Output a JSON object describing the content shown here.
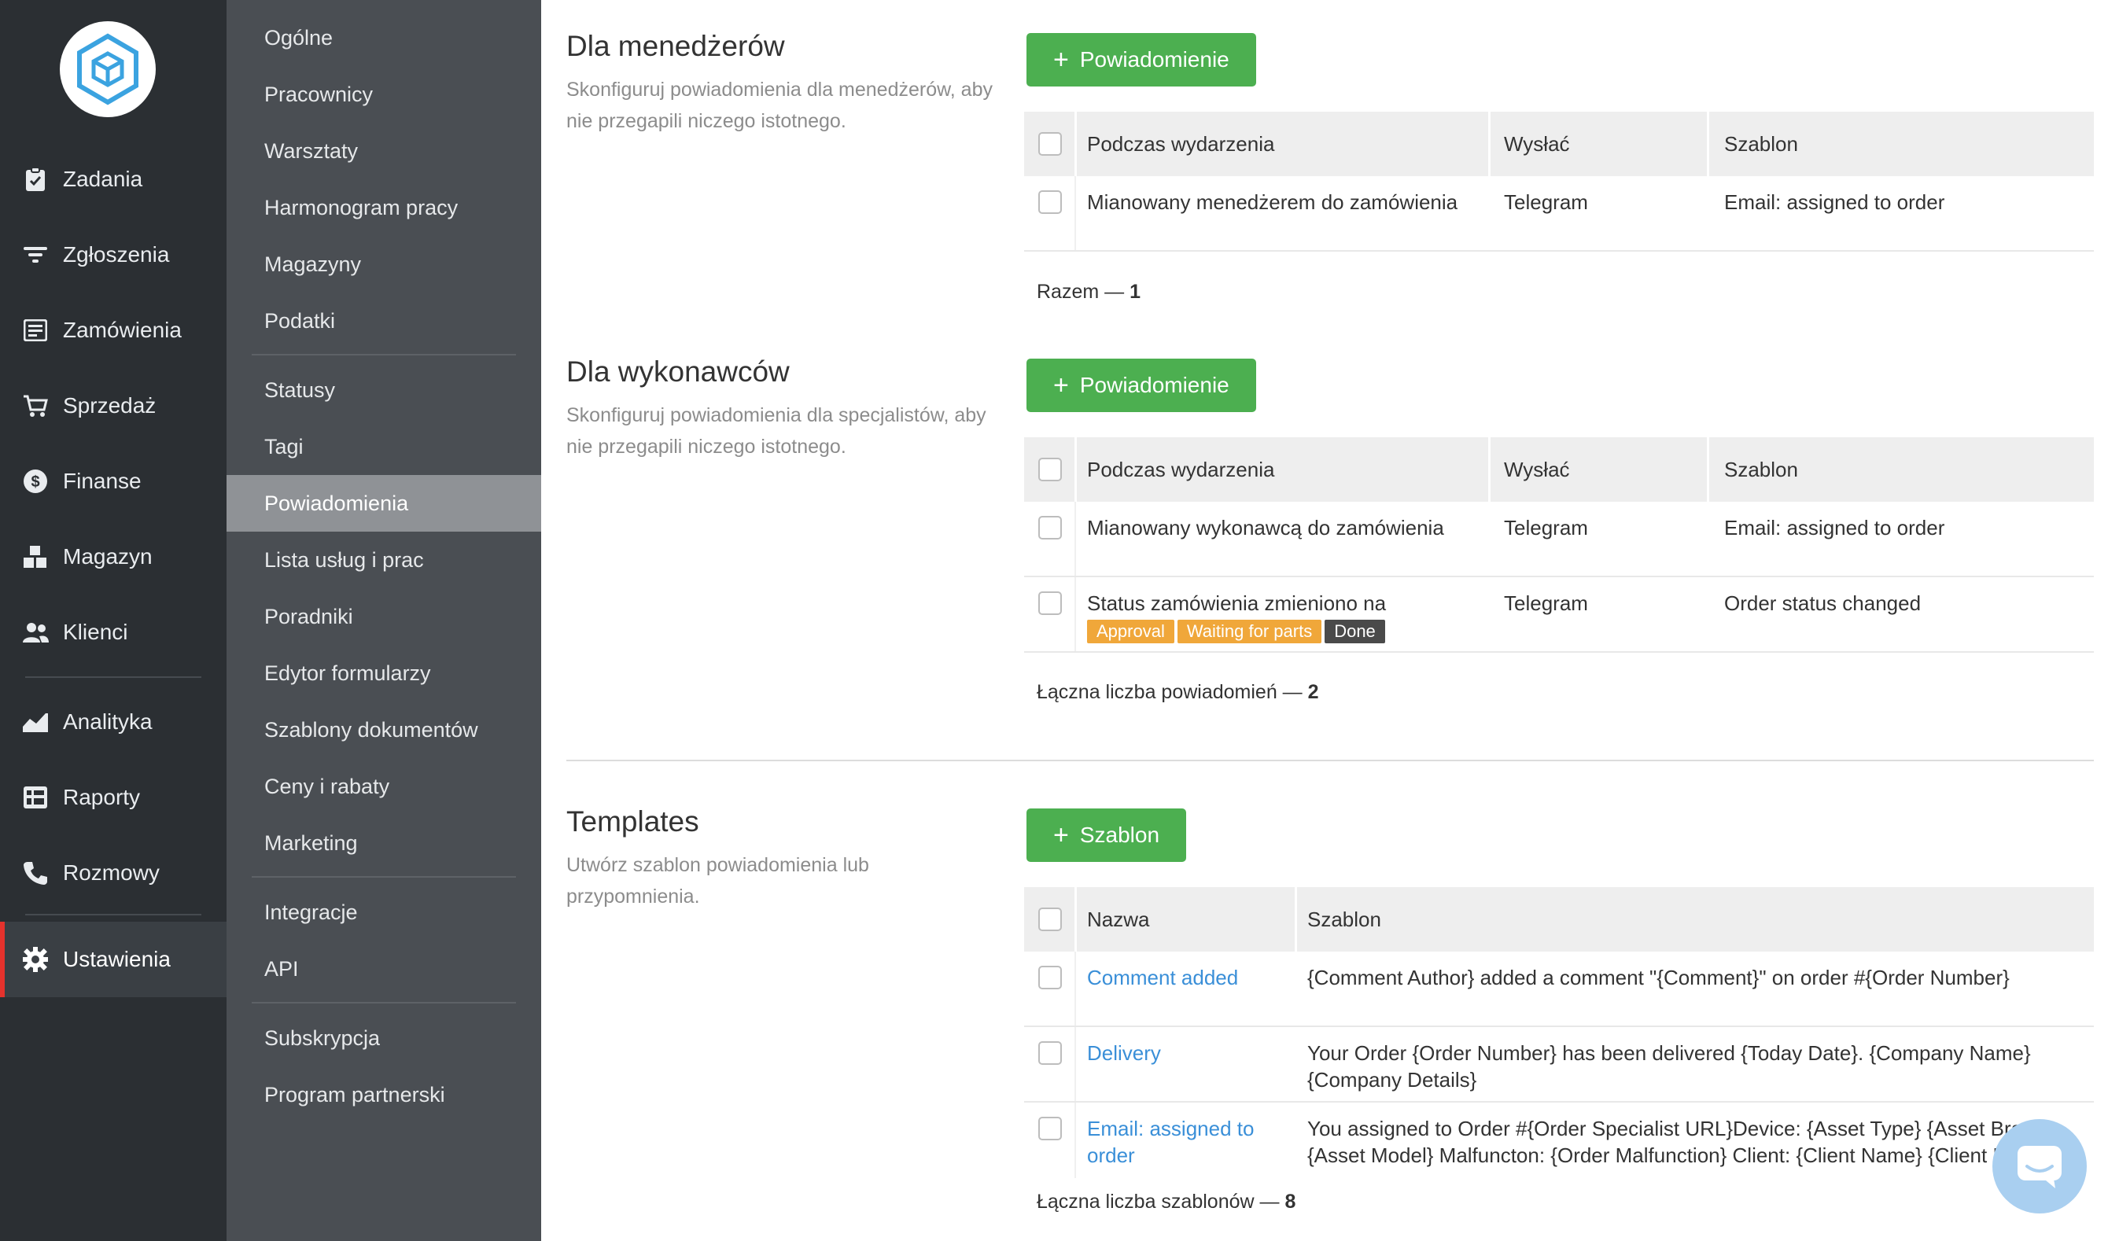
{
  "nav": {
    "items": [
      {
        "label": "Zadania",
        "icon": "clipboard-check-icon"
      },
      {
        "label": "Zgłoszenia",
        "icon": "filter-icon"
      },
      {
        "label": "Zamówienia",
        "icon": "order-form-icon"
      },
      {
        "label": "Sprzedaż",
        "icon": "cart-icon"
      },
      {
        "label": "Finanse",
        "icon": "dollar-icon"
      },
      {
        "label": "Magazyn",
        "icon": "boxes-icon"
      },
      {
        "label": "Klienci",
        "icon": "people-icon"
      },
      {
        "label": "Analityka",
        "icon": "chart-area-icon"
      },
      {
        "label": "Raporty",
        "icon": "report-grid-icon"
      },
      {
        "label": "Rozmowy",
        "icon": "phone-icon"
      },
      {
        "label": "Ustawienia",
        "icon": "gear-icon"
      }
    ],
    "active": "Ustawienia"
  },
  "submenu": {
    "items": [
      "Ogólne",
      "Pracownicy",
      "Warsztaty",
      "Harmonogram pracy",
      "Magazyny",
      "Podatki",
      "Statusy",
      "Tagi",
      "Powiadomienia",
      "Lista usług i prac",
      "Poradniki",
      "Edytor formularzy",
      "Szablony dokumentów",
      "Ceny i rabaty",
      "Marketing",
      "Integracje",
      "API",
      "Subskrypcja",
      "Program partnerski"
    ],
    "active": "Powiadomienia"
  },
  "managers": {
    "title": "Dla menedżerów",
    "description": "Skonfiguruj powiadomienia dla menedżerów, aby nie przegapili niczego istotnego.",
    "button": "Powiadomienie",
    "columns": [
      "Podczas wydarzenia",
      "Wysłać",
      "Szablon"
    ],
    "rows": [
      {
        "event": "Mianowany menedżerem do zamówienia",
        "send": "Telegram",
        "template": "Email: assigned to order"
      }
    ],
    "total_label": "Razem —",
    "total_value": "1"
  },
  "performers": {
    "title": "Dla wykonawców",
    "description": "Skonfiguruj powiadomienia dla specjalistów, aby nie przegapili niczego istotnego.",
    "button": "Powiadomienie",
    "columns": [
      "Podczas wydarzenia",
      "Wysłać",
      "Szablon"
    ],
    "rows": [
      {
        "event": "Mianowany wykonawcą do zamówienia",
        "send": "Telegram",
        "template": "Email: assigned to order"
      },
      {
        "event": "Status zamówienia zmieniono na",
        "send": "Telegram",
        "template": "Order status changed",
        "badges": [
          {
            "text": "Approval",
            "color": "#f0a73a"
          },
          {
            "text": "Waiting for parts",
            "color": "#f0a73a"
          },
          {
            "text": "Done",
            "color": "#4a4a4a"
          }
        ]
      }
    ],
    "total_label": "Łączna liczba powiadomień —",
    "total_value": "2"
  },
  "templates": {
    "title": "Templates",
    "description": "Utwórz szablon powiadomienia lub przypomnienia.",
    "button": "Szablon",
    "columns": [
      "Nazwa",
      "Szablon"
    ],
    "rows": [
      {
        "name": "Comment added",
        "body": "{Comment Author} added a comment \"{Comment}\" on order #{Order Number}"
      },
      {
        "name": "Delivery",
        "body": "Your Order {Order Number} has been delivered {Today Date}. {Company Name} {Company Details}"
      },
      {
        "name": "Email: assigned to order",
        "body": "You assigned to Order #{Order Specialist URL}Device: {Asset Type} {Asset Brand} {Asset Model} Malfuncton: {Order Malfunction} Client: {Client Name} {Client Phone}"
      }
    ],
    "total_label": "Łączna liczba szablonów —",
    "total_value": "8"
  },
  "colors": {
    "accent_green": "#4caf50",
    "link_blue": "#3a8fd8",
    "active_red": "#e5322d"
  }
}
